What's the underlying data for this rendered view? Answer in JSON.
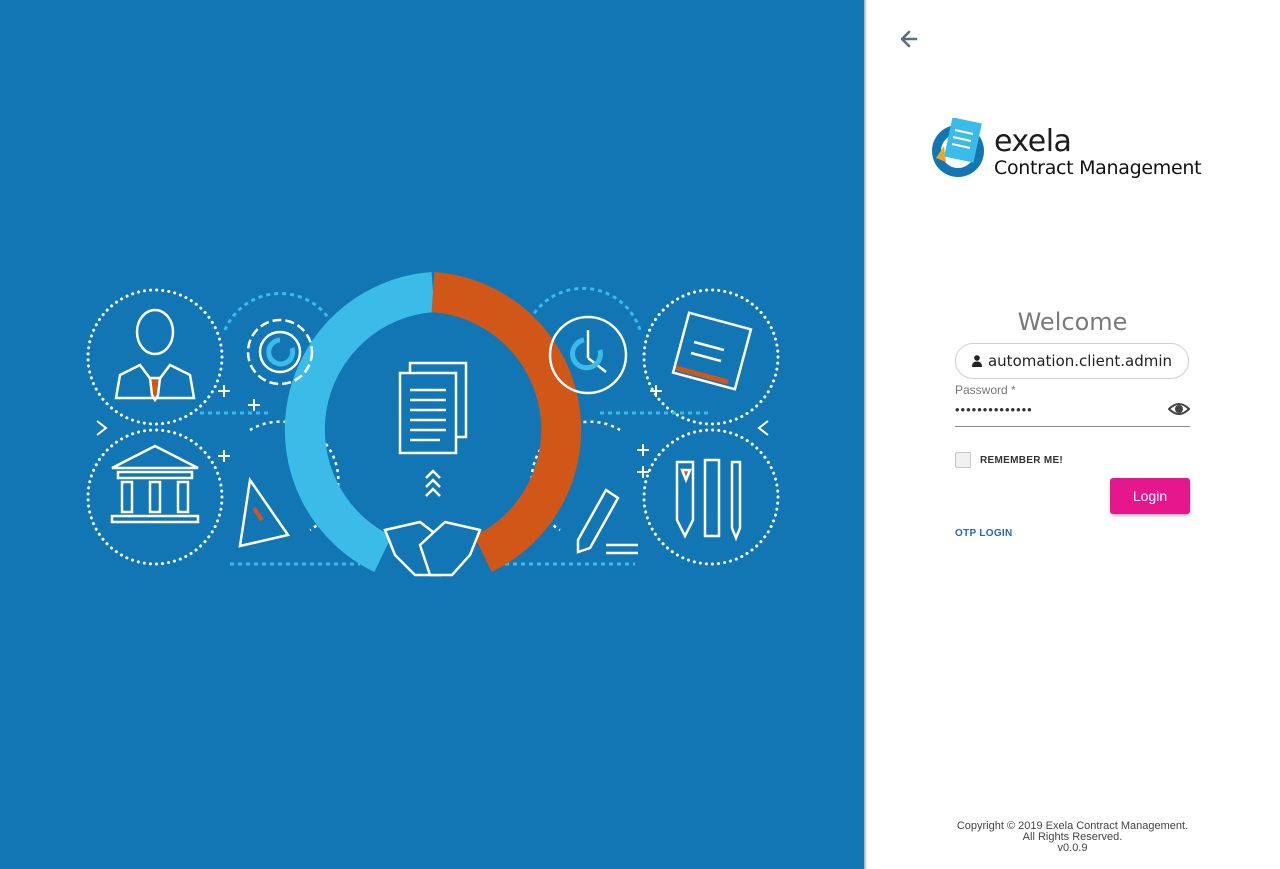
{
  "brand": {
    "word": "exela",
    "product": "Contract Management"
  },
  "login": {
    "welcome": "Welcome",
    "username_value": "automation.client.admin",
    "password_label": "Password *",
    "password_value": "••••••••••••••",
    "remember_label": "REMEMBER ME!",
    "remember_checked": false,
    "login_label": "Login",
    "otp_label": "OTP LOGIN"
  },
  "footer": {
    "copyright": "Copyright © 2019 Exela Contract Management.",
    "rights": "All Rights Reserved.",
    "version": "v0.0.9"
  },
  "icons": {
    "back": "arrow-left-icon",
    "user": "user-icon",
    "eye": "eye-icon"
  },
  "colors": {
    "panel_blue": "#1276b5",
    "ring_light_blue": "#3bbbe8",
    "ring_orange": "#d05718",
    "login_button": "#e6178d",
    "otp_link": "#2a64b8"
  }
}
